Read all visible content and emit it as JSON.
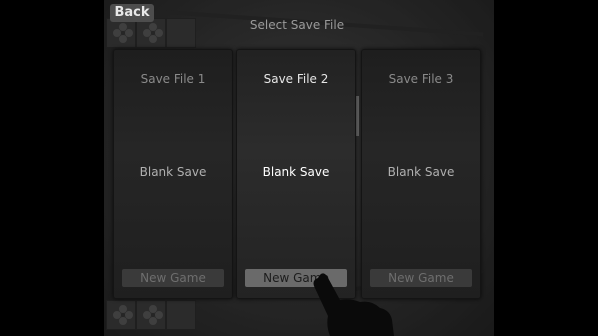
{
  "header": {
    "back_label": "Back",
    "title": "Select Save File"
  },
  "slots": [
    {
      "name": "Save File 1",
      "state": "Blank Save",
      "action": "New Game",
      "selected": false
    },
    {
      "name": "Save File 2",
      "state": "Blank Save",
      "action": "New Game",
      "selected": true
    },
    {
      "name": "Save File 3",
      "state": "Blank Save",
      "action": "New Game",
      "selected": false
    }
  ],
  "colors": {
    "letterbox": "#000000",
    "panel": "#262626",
    "selected_button": "#6a6a6a"
  }
}
